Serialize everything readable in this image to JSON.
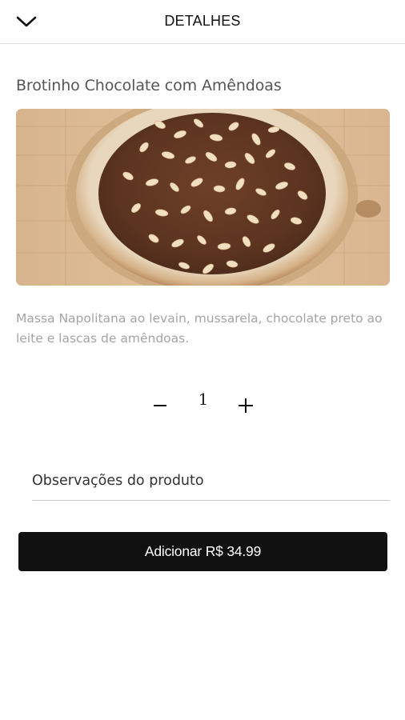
{
  "header": {
    "title": "DETALHES",
    "back_icon": "chevron-down-icon"
  },
  "product": {
    "name": "Brotinho Chocolate com Amêndoas",
    "description": "Massa Napolitana ao levain, mussarela, chocolate preto ao leite e lascas de amêndoas.",
    "quantity": "1"
  },
  "notes": {
    "placeholder": "Observações do produto",
    "value": ""
  },
  "actions": {
    "add_label": "Adicionar R$ 34.99"
  },
  "colors": {
    "button_bg": "#111111",
    "button_text": "#ffffff",
    "description_text": "#a4a4a4"
  }
}
